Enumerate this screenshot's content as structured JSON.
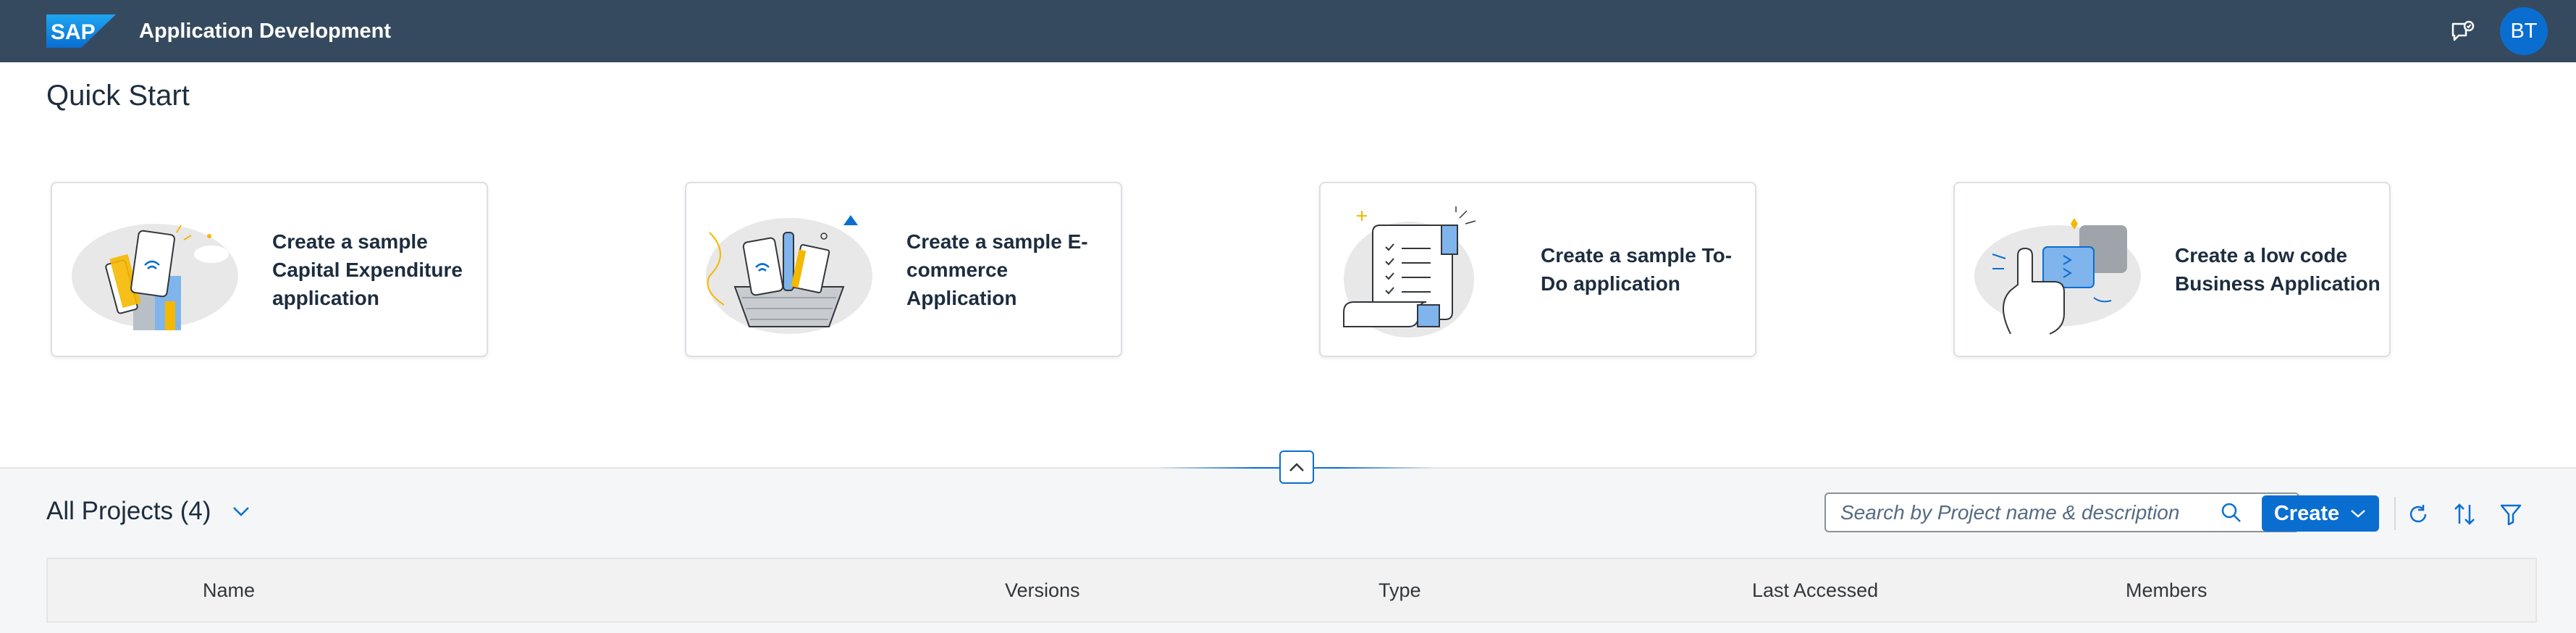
{
  "shell": {
    "logo_text": "SAP",
    "title": "Application Development",
    "user_initials": "BT"
  },
  "quick_start": {
    "title": "Quick Start",
    "cards": [
      {
        "label": "Create a sample Capital Expenditure application"
      },
      {
        "label": "Create a sample E-commerce Application"
      },
      {
        "label": "Create a sample To-Do application"
      },
      {
        "label": "Create a low code Business Application"
      }
    ]
  },
  "projects": {
    "title": "All Projects (4)",
    "search_placeholder": "Search by Project name & description",
    "create_label": "Create",
    "columns": [
      "Name",
      "Versions",
      "Type",
      "Last Accessed",
      "Members"
    ]
  },
  "icons": {
    "feedback": "feedback-icon",
    "collapse": "chevron-up-icon",
    "search": "search-icon",
    "refresh": "refresh-icon",
    "sort": "sort-icon",
    "filter": "filter-icon"
  },
  "colors": {
    "shell": "#354a5f",
    "accent": "#0a6ed1",
    "band": "#f5f6f7"
  }
}
